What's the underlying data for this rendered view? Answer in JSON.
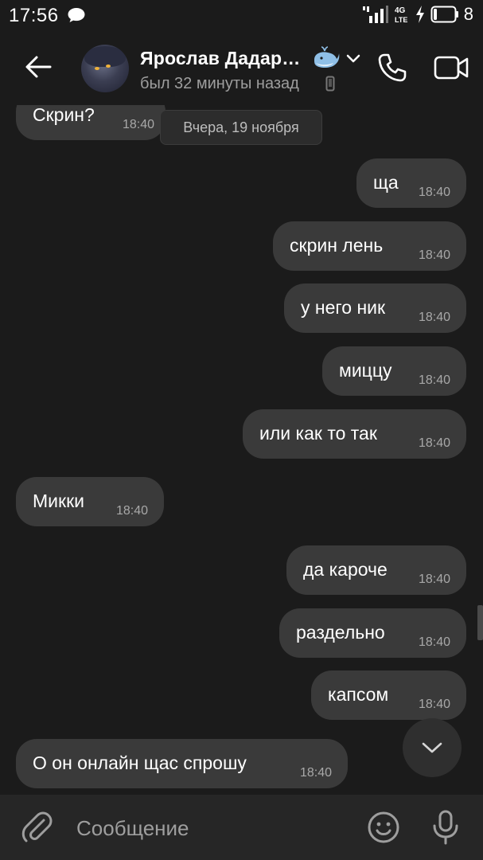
{
  "status_bar": {
    "time": "17:56",
    "network": "4G LTE",
    "battery": "8",
    "icons": [
      "chat-bubble-icon",
      "signal-icon",
      "network-4g-icon",
      "charging-icon",
      "battery-icon"
    ]
  },
  "header": {
    "contact_name": "Ярослав Дадар…",
    "last_seen": "был 32 минуты назад",
    "icons": [
      "back-arrow-icon",
      "avatar",
      "whale-emoji",
      "chevron-down-icon",
      "phone-icon",
      "call-icon",
      "video-call-icon"
    ]
  },
  "chat": {
    "date_separator": "Вчера, 19 ноября",
    "messages": [
      {
        "text": "Скрин?",
        "time": "18:40",
        "side": "in"
      },
      {
        "text": "ща",
        "time": "18:40",
        "side": "out"
      },
      {
        "text": "скрин лень",
        "time": "18:40",
        "side": "out"
      },
      {
        "text": "у него ник",
        "time": "18:40",
        "side": "out"
      },
      {
        "text": "миццу",
        "time": "18:40",
        "side": "out"
      },
      {
        "text": "или как то так",
        "time": "18:40",
        "side": "out"
      },
      {
        "text": "Микки",
        "time": "18:40",
        "side": "in"
      },
      {
        "text": "да кароче",
        "time": "18:40",
        "side": "out"
      },
      {
        "text": "раздельно",
        "time": "18:40",
        "side": "out"
      },
      {
        "text": "капсом",
        "time": "18:40",
        "side": "out"
      },
      {
        "text": "О он онлайн щас спрошу",
        "time": "18:40",
        "side": "in"
      }
    ]
  },
  "composer": {
    "placeholder": "Сообщение",
    "icons": [
      "paperclip-icon",
      "emoji-icon",
      "microphone-icon"
    ]
  },
  "colors": {
    "background": "#1b1b1b",
    "bubble": "#3a3a3a",
    "composer": "#262626",
    "muted_text": "#9e9e9e"
  }
}
